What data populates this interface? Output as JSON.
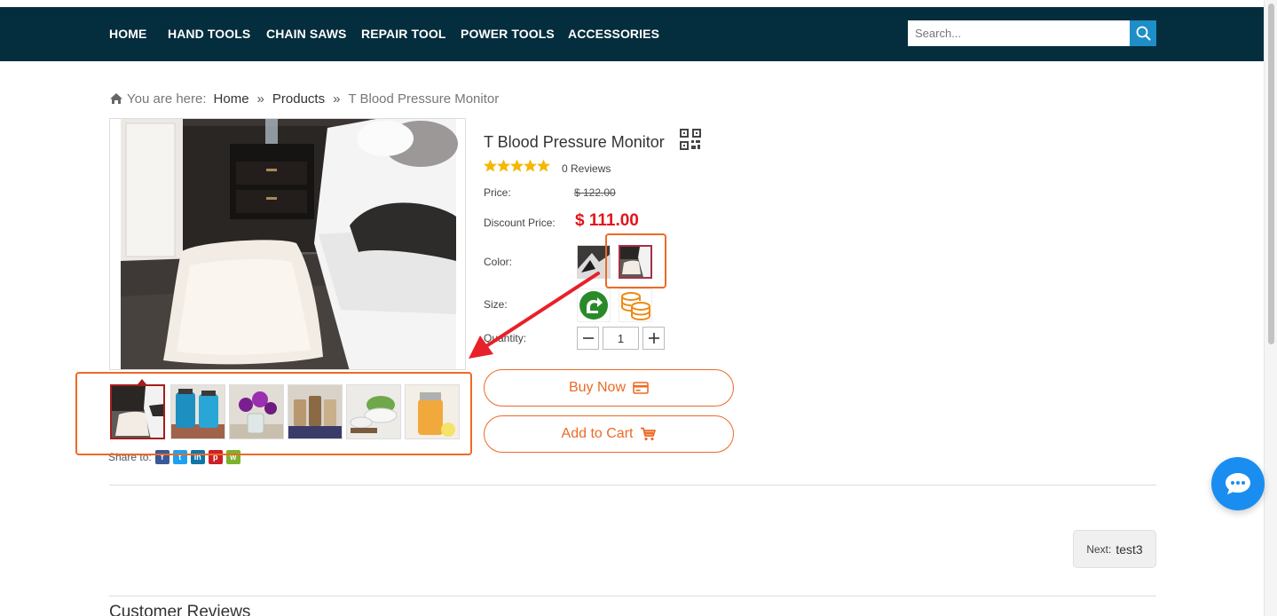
{
  "nav": {
    "items": [
      "HOME",
      "HAND TOOLS",
      "CHAIN SAWS",
      "REPAIR TOOL",
      "POWER TOOLS",
      "ACCESSORIES"
    ],
    "search_placeholder": "Search..."
  },
  "breadcrumb": {
    "prefix": "You are here:",
    "home": "Home",
    "products": "Products",
    "current": "T Blood Pressure Monitor",
    "separator": "»"
  },
  "product": {
    "title": "T Blood Pressure Monitor",
    "rating": 5,
    "reviews_label": "0 Reviews",
    "price_label": "Price:",
    "price": "$ 122.00",
    "discount_label": "Discount Price:",
    "discount_price": "$ 111.00",
    "color_label": "Color:",
    "size_label": "Size:",
    "quantity_label": "Quantity:",
    "quantity_value": "1",
    "buy_now": "Buy Now",
    "add_to_cart": "Add to Cart",
    "share_label": "Share to:"
  },
  "navigation": {
    "next_label": "Next:",
    "next_title": "test3"
  },
  "reviews_section": {
    "title": "Customer Reviews"
  },
  "colors": {
    "nav_bg": "#042d3d",
    "accent_orange": "#ec6a26",
    "price_red": "#e0151b",
    "search_blue": "#1e8ec7",
    "chat_blue": "#1a8ef0",
    "annotation_red": "#e8202a"
  },
  "icons": {
    "search": "search-icon",
    "home": "home-icon",
    "qr": "qr-code-icon",
    "star": "star-icon",
    "card": "credit-card-icon",
    "cart": "cart-icon",
    "chat": "chat-icon",
    "share": [
      "facebook-icon",
      "twitter-icon",
      "linkedin-icon",
      "pinterest-icon",
      "wechat-icon"
    ]
  }
}
